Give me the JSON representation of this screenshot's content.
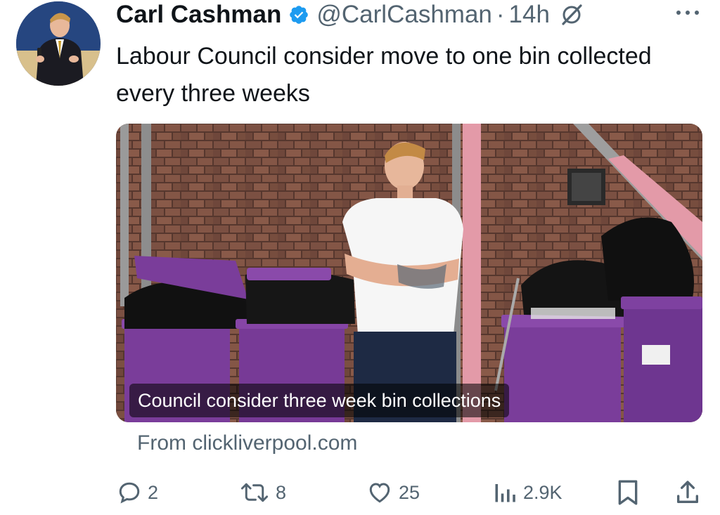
{
  "author": {
    "name": "Carl Cashman",
    "handle": "@CarlCashman",
    "separator": "·",
    "time": "14h",
    "verified": true
  },
  "tweet": {
    "text": "Labour Council consider move to one bin collected every three weeks"
  },
  "media": {
    "caption": "Council consider three week bin collections",
    "source": "From clickliverpool.com"
  },
  "actions": {
    "replies": "2",
    "reposts": "8",
    "likes": "25",
    "views": "2.9K"
  },
  "colors": {
    "verified": "#1d9bf0",
    "secondary_text": "#536471",
    "primary_text": "#0f1419",
    "bin_purple": "#7a3d9a"
  },
  "icons": [
    "verified-badge-icon",
    "grok-icon",
    "more-icon",
    "reply-icon",
    "repost-icon",
    "like-icon",
    "views-icon",
    "bookmark-icon",
    "share-icon"
  ]
}
